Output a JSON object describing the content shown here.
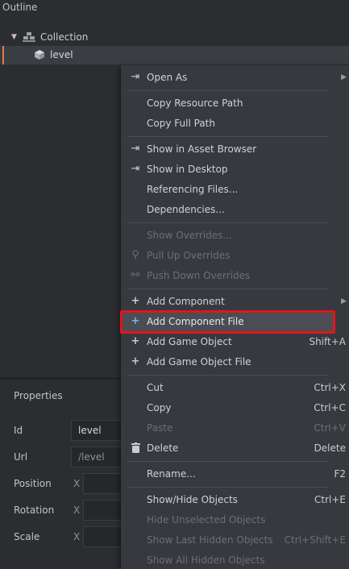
{
  "outline": {
    "title": "Outline",
    "tree": {
      "collection_label": "Collection",
      "level_label": "level"
    }
  },
  "properties": {
    "title": "Properties",
    "fields": [
      {
        "label": "Id",
        "value": "level"
      },
      {
        "label": "Url",
        "value": "/level"
      },
      {
        "label": "Position",
        "axis": "X"
      },
      {
        "label": "Rotation",
        "axis": "X"
      },
      {
        "label": "Scale",
        "axis": "X"
      }
    ]
  },
  "menu": {
    "items": [
      {
        "id": "open-as",
        "label": "Open As",
        "icon": "open-arrow-icon",
        "submenu": true,
        "enabled": true
      },
      {
        "id": "copy-resource-path",
        "label": "Copy Resource Path",
        "enabled": true
      },
      {
        "id": "copy-full-path",
        "label": "Copy Full Path",
        "enabled": true
      },
      {
        "id": "show-in-asset-browser",
        "label": "Show in Asset Browser",
        "icon": "open-arrow-icon",
        "enabled": true
      },
      {
        "id": "show-in-desktop",
        "label": "Show in Desktop",
        "icon": "open-arrow-icon",
        "enabled": true
      },
      {
        "id": "referencing-files",
        "label": "Referencing Files...",
        "enabled": true
      },
      {
        "id": "dependencies",
        "label": "Dependencies...",
        "enabled": true
      },
      {
        "id": "show-overrides",
        "label": "Show Overrides...",
        "enabled": false
      },
      {
        "id": "pull-up-overrides",
        "label": "Pull Up Overrides",
        "icon": "pull-up-icon",
        "enabled": false
      },
      {
        "id": "push-down-overrides",
        "label": "Push Down Overrides",
        "icon": "push-down-icon",
        "enabled": false
      },
      {
        "id": "add-component",
        "label": "Add Component",
        "icon": "plus-icon",
        "submenu": true,
        "enabled": true
      },
      {
        "id": "add-component-file",
        "label": "Add Component File",
        "icon": "plus-icon",
        "enabled": true,
        "highlighted": true
      },
      {
        "id": "add-game-object",
        "label": "Add Game Object",
        "icon": "plus-icon",
        "shortcut": "Shift+A",
        "enabled": true
      },
      {
        "id": "add-game-object-file",
        "label": "Add Game Object File",
        "icon": "plus-icon",
        "enabled": true
      },
      {
        "id": "cut",
        "label": "Cut",
        "shortcut": "Ctrl+X",
        "enabled": true
      },
      {
        "id": "copy",
        "label": "Copy",
        "shortcut": "Ctrl+C",
        "enabled": true
      },
      {
        "id": "paste",
        "label": "Paste",
        "shortcut": "Ctrl+V",
        "enabled": false
      },
      {
        "id": "delete",
        "label": "Delete",
        "icon": "trash-icon",
        "shortcut": "Delete",
        "enabled": true
      },
      {
        "id": "rename",
        "label": "Rename...",
        "shortcut": "F2",
        "enabled": true
      },
      {
        "id": "show-hide-objects",
        "label": "Show/Hide Objects",
        "shortcut": "Ctrl+E",
        "enabled": true
      },
      {
        "id": "hide-unselected-objects",
        "label": "Hide Unselected Objects",
        "enabled": false
      },
      {
        "id": "show-last-hidden-objects",
        "label": "Show Last Hidden Objects",
        "shortcut": "Ctrl+Shift+E",
        "enabled": false
      },
      {
        "id": "show-all-hidden-objects",
        "label": "Show All Hidden Objects",
        "enabled": false
      }
    ]
  },
  "colors": {
    "background": "#2b2d31",
    "menu_background": "#37393e",
    "highlight": "#4a4d53",
    "selection_accent": "#e07a4a",
    "annotation_red": "#e3151b",
    "plus_icon": "#7fb2e8"
  }
}
